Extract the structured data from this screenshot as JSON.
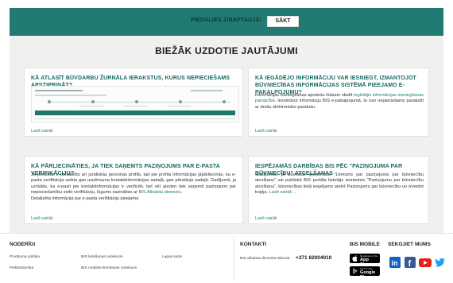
{
  "banner": {
    "label": "Piedalies zibaptaujā!",
    "button": "Sākt",
    "color": "#217b72"
  },
  "faq": {
    "title": "Biežāk uzdotie jautājumi",
    "more_label": "Lasīt vairāk",
    "cards": [
      {
        "title": "Kā atlasīt būvdarbu žurnāla ierakstus, kurus nepieciešams apstiprināt?",
        "has_screenshot": true
      },
      {
        "title": "Kā iegādējo informāciju var iesniegt, izmantojot būvniecības informācijas sistēmā pieejamo e-pakalpojumu?",
        "text_pre": "Informācijas iesniegšanas aprakstu lūdzam skatīt ",
        "text_link": "iegādējis informācijas iesniegšanas pamācībā",
        "text_post": ". Iesniedzot informāciju BIS e-pakalpojumā, to nav nepieciešams parakstīt ar drošu elektronisko parakstu."
      },
      {
        "title": "Kā pārliecināties, ja tiek saņemts paziņojums par e-pasta verifikāciju?",
        "text": "Ja personai ir piesaistīts arī juridiskās personas profils, tad pie profila informācijas jāpārliecinās, ka e-pasta verifikācija veikta gan uzņēmuma kontaktinformācijas sadaļā, gan pārstāvja sadaļā. Gadījumā, ja uzrādās, ka e-pasti pie kontaktinformācijas ir verificēti, bet vēl aizvien tiek saņemti paziņojumi par nepieciešamību veikt verifikāciju, lūgums sazināties ar ",
        "text_link": "BIS Atbalsta dienestu",
        "text_tail": ".",
        "text2": "Detalizēta informācija par e-pasta verifikāciju pieejama"
      },
      {
        "title": "Iespējamās darbības BIS pēc \"Paziņojuma par būvniecību\" atcelšanas",
        "text": "Gadījumos, ja būvvaldē pieņemtusi \"Lēmums par paziņojuma par būvniecību atcelšanu\" vai publiskā BIS portāla lietotājs iesniedzis \"Paziņojumu par būvniecību atcelšanu\", būvniecības lietā iespējams atvērt Paziņojumu par būvniecību un izveidot kopiju. ",
        "text_link": "Lasīt vairāk ..."
      }
    ]
  },
  "footer": {
    "noderigi": {
      "title": "Noderīgi",
      "links": [
        "Privātuma politika",
        "BIS lietošanas noteikumi",
        "Lapas karte",
        "Piekļūstamība",
        "BIS mobilās lietošanas noteikumi"
      ]
    },
    "kontakti": {
      "title": "Kontakti",
      "support_label": "BIS atbalsta dienesta tālrunis:",
      "phone": "+371 62004010"
    },
    "mobile": {
      "title": "BIS mobile",
      "app_store_sub": "Download on the",
      "app_store": "App Store",
      "google_play_sub": "GET IT ON",
      "google_play": "Google Play"
    },
    "social": {
      "title": "Sekojiet mums",
      "icons": [
        "linkedin-icon",
        "facebook-icon",
        "youtube-icon",
        "twitter-icon"
      ]
    }
  }
}
